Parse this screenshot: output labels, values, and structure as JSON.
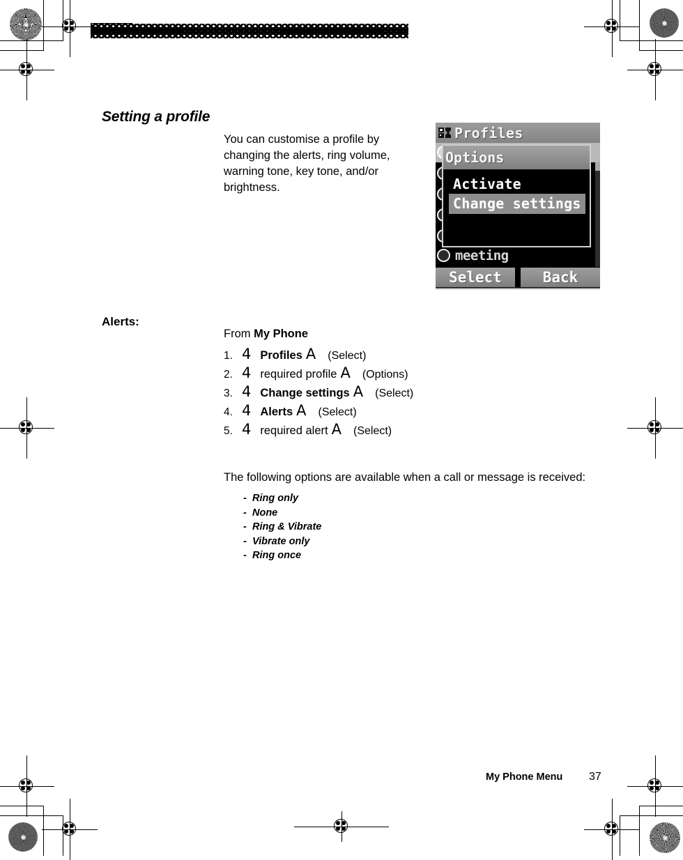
{
  "page": {
    "section_title": "Setting a profile",
    "intro": "You can customise a profile by changing the alerts, ring volume, warning tone, key tone, and/or brightness.",
    "alerts_label": "Alerts:",
    "from_prefix": "From ",
    "from_menu": "My Phone",
    "following_text": "The following options are available when a call or message is received:"
  },
  "steps": [
    {
      "num": "1.",
      "nav": "4",
      "item": "Profiles",
      "bold": true,
      "select": "A",
      "softkey": "(Select)"
    },
    {
      "num": "2.",
      "nav": "4",
      "item": "required profile",
      "bold": false,
      "select": "A",
      "softkey": "(Options)"
    },
    {
      "num": "3.",
      "nav": "4",
      "item": "Change settings",
      "bold": true,
      "select": "A",
      "softkey": "(Select)"
    },
    {
      "num": "4.",
      "nav": "4",
      "item": "Alerts",
      "bold": true,
      "select": "A",
      "softkey": "(Select)"
    },
    {
      "num": "5.",
      "nav": "4",
      "item": "required alert",
      "bold": false,
      "select": "A",
      "softkey": "(Select)"
    }
  ],
  "options": [
    {
      "dash": "-",
      "label": "Ring only"
    },
    {
      "dash": "-",
      "label": "None"
    },
    {
      "dash": "-",
      "label": "Ring & Vibrate"
    },
    {
      "dash": "-",
      "label": "Vibrate only"
    },
    {
      "dash": "-",
      "label": "Ring once"
    }
  ],
  "footer": {
    "title": "My Phone Menu",
    "page_number": "37"
  },
  "phone_screen": {
    "title": "Profiles",
    "popup_header": "Options",
    "menu_items": [
      {
        "label": "Activate",
        "highlighted": false
      },
      {
        "label": "Change settings",
        "highlighted": true
      }
    ],
    "background_last_item": "meeting",
    "softkey_left": "Select",
    "softkey_right": "Back"
  },
  "colors": {
    "page_background": "#ffffff",
    "text": "#000000",
    "screen_background": "#000000",
    "screen_titlebar": "#909090",
    "screen_highlight": "#8d8d8d",
    "screen_text": "#ffffff"
  }
}
